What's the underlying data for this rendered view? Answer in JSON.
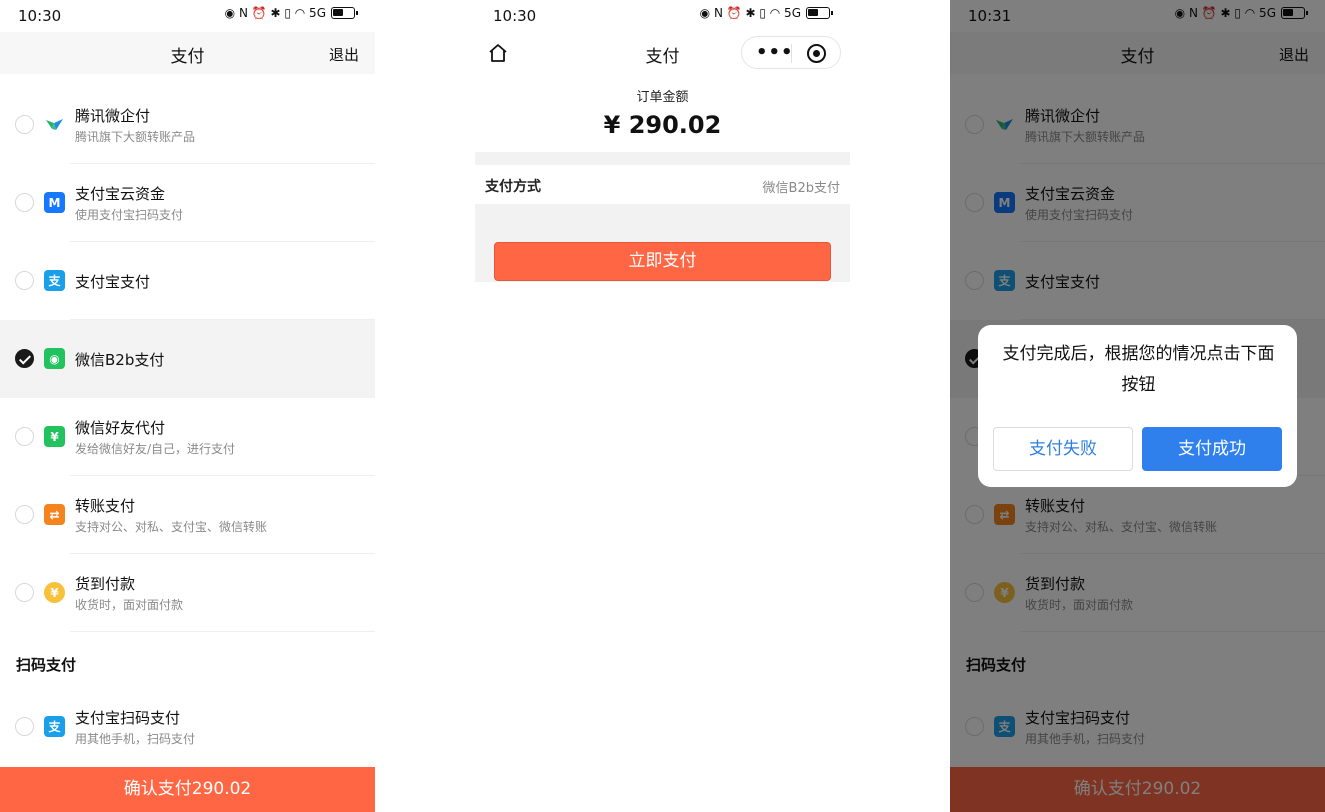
{
  "panel_list": {
    "status_time": "10:30",
    "nav_title": "支付",
    "nav_exit": "退出",
    "items": [
      {
        "title": "腾讯微企付",
        "sub": "腾讯旗下大额转账产品",
        "icon": "tencent-wepay-icon",
        "color": "#2cb36b"
      },
      {
        "title": "支付宝云资金",
        "sub": "使用支付宝扫码支付",
        "icon": "alipay-cloud-icon",
        "color": "#1677ff"
      },
      {
        "title": "支付宝支付",
        "sub": "",
        "icon": "alipay-icon",
        "color": "#1aa0e8"
      },
      {
        "title": "微信B2b支付",
        "sub": "",
        "icon": "wechat-b2b-icon",
        "color": "#22c35e"
      },
      {
        "title": "微信好友代付",
        "sub": "发给微信好友/自己，进行支付",
        "icon": "wechat-friend-pay-icon",
        "color": "#22c35e"
      },
      {
        "title": "转账支付",
        "sub": "支持对公、对私、支付宝、微信转账",
        "icon": "transfer-icon",
        "color": "#f5841f"
      },
      {
        "title": "货到付款",
        "sub": "收货时，面对面付款",
        "icon": "cod-icon",
        "color": "#f7c23a"
      }
    ],
    "section_scan": "扫码支付",
    "scan_item": {
      "title": "支付宝扫码支付",
      "sub": "用其他手机，扫码支付",
      "icon": "alipay-scan-icon",
      "color": "#1aa0e8"
    },
    "confirm": "确认支付290.02"
  },
  "panel_order": {
    "status_time": "10:30",
    "nav_title": "支付",
    "order_label": "订单金额",
    "order_amount": "¥ 290.02",
    "method_label": "支付方式",
    "method_value": "微信B2b支付",
    "pay_now": "立即支付"
  },
  "panel_dialog": {
    "status_time": "10:31",
    "message": "支付完成后，根据您的情况点击下面按钮",
    "fail_label": "支付失败",
    "success_label": "支付成功"
  },
  "selected_item": "微信B2b支付",
  "status_icons": "◉ N ⏰ ✱ ▯ ◠ 5G"
}
